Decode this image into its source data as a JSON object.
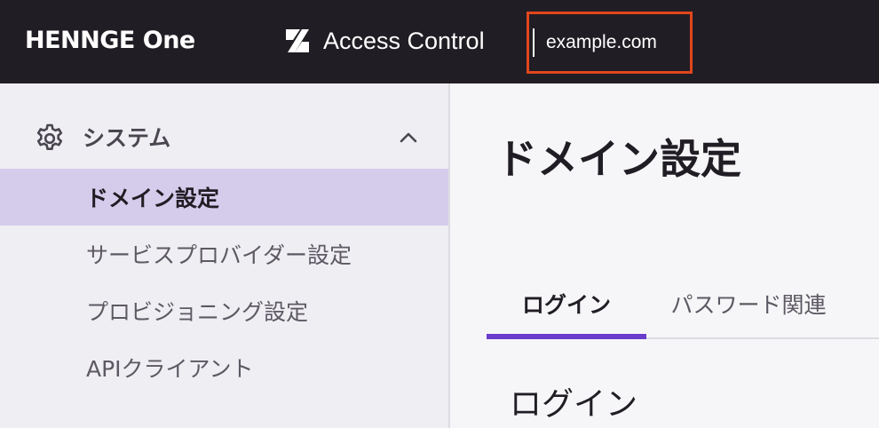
{
  "header": {
    "brand": "HENNGE One",
    "product": "Access Control",
    "tenant": "example.com"
  },
  "sidebar": {
    "section_label": "システム",
    "items": [
      {
        "label": "ドメイン設定",
        "active": true
      },
      {
        "label": "サービスプロバイダー設定",
        "active": false
      },
      {
        "label": "プロビジョニング設定",
        "active": false
      },
      {
        "label": "APIクライアント",
        "active": false
      }
    ]
  },
  "main": {
    "title": "ドメイン設定",
    "tabs": [
      {
        "label": "ログイン",
        "active": true
      },
      {
        "label": "パスワード関連",
        "active": false
      }
    ],
    "section_title": "ログイン"
  },
  "colors": {
    "header_bg": "#211d24",
    "highlight_box": "#e2461d",
    "active_nav_bg": "#d5ccec",
    "tab_accent": "#6a3ccc"
  },
  "icons": [
    "product-logo-icon",
    "gear-icon",
    "chevron-up-icon"
  ]
}
